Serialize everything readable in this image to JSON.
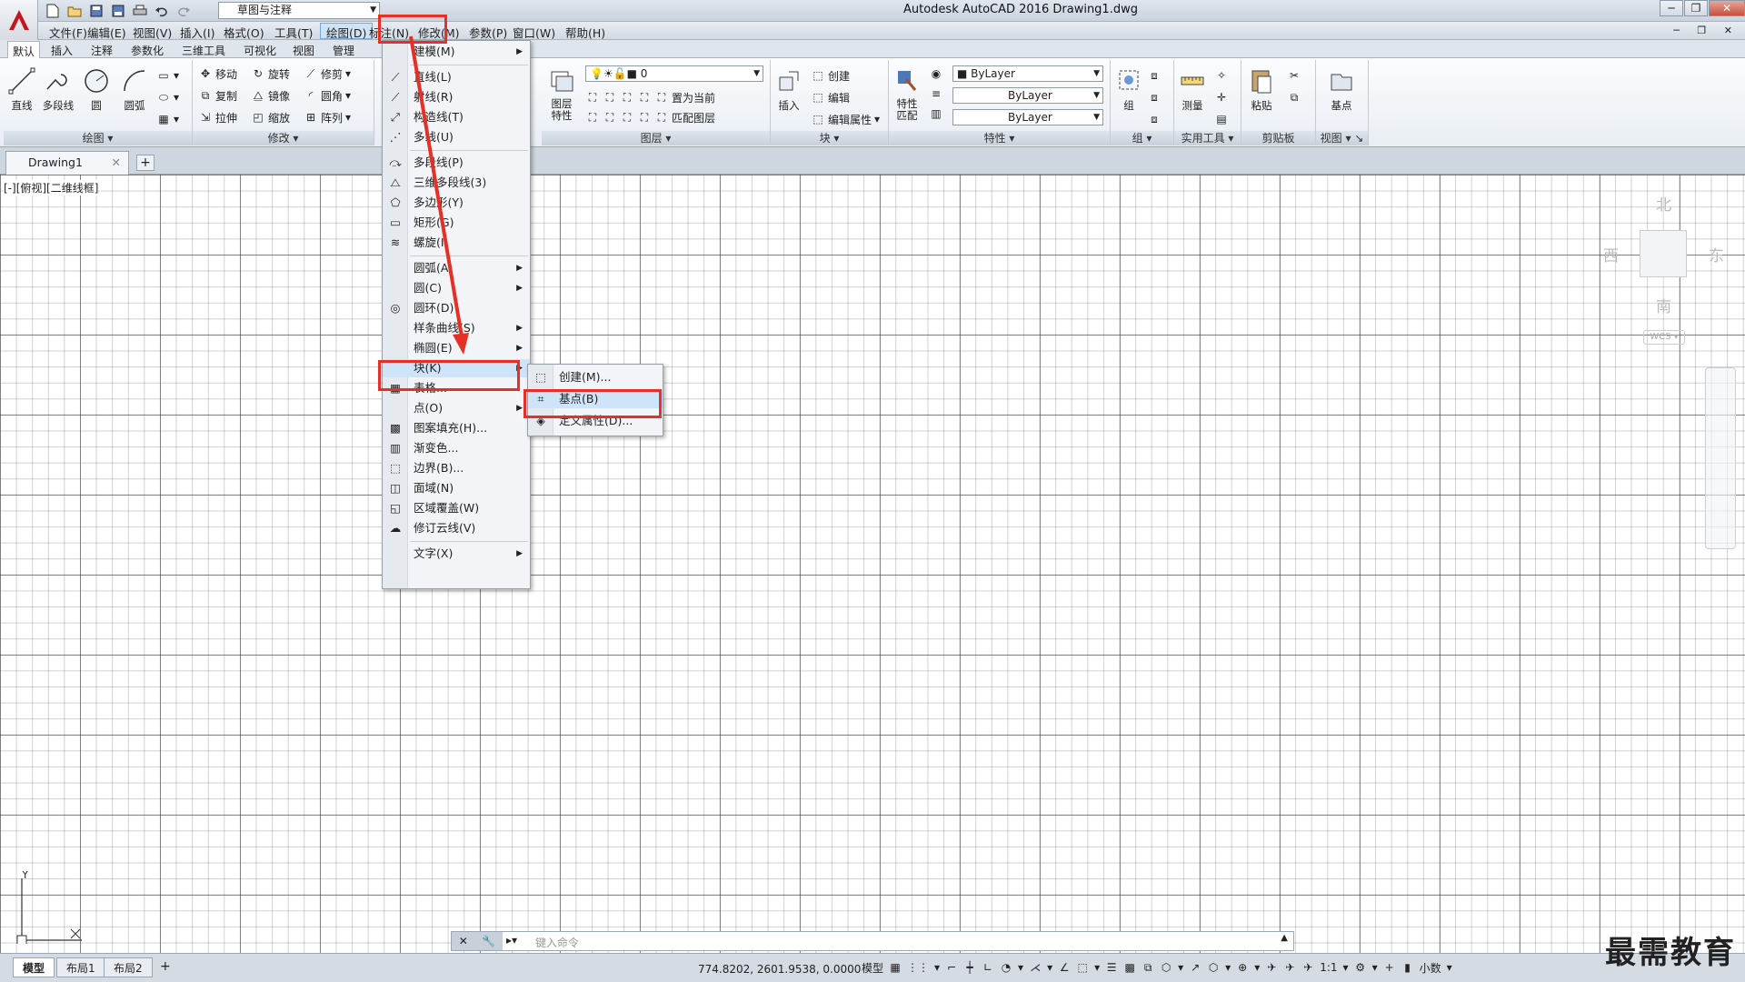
{
  "app": {
    "title": "Autodesk AutoCAD 2016    Drawing1.dwg",
    "workspace": "草图与注释"
  },
  "menubar": [
    "文件(F)",
    "编辑(E)",
    "视图(V)",
    "插入(I)",
    "格式(O)",
    "工具(T)",
    "绘图(D)",
    "标注(N)",
    "修改(M)",
    "参数(P)",
    "窗口(W)",
    "帮助(H)"
  ],
  "ribbon_tabs": [
    "默认",
    "插入",
    "注释",
    "参数化",
    "三维工具",
    "可视化",
    "视图",
    "管理"
  ],
  "panels": {
    "draw": {
      "title": "绘图",
      "line": "直线",
      "polyline": "多段线",
      "circle": "圆",
      "arc": "圆弧"
    },
    "modify": {
      "title": "修改",
      "move": "移动",
      "rotate": "旋转",
      "trim": "修剪",
      "copy": "复制",
      "mirror": "镜像",
      "fillet": "圆角",
      "stretch": "拉伸",
      "scale": "缩放",
      "array": "阵列"
    },
    "layer": {
      "title": "图层",
      "props": "图层\n特性",
      "layer0": "0",
      "setcurrent": "置为当前",
      "match": "匹配图层"
    },
    "block": {
      "title": "块",
      "insert": "插入",
      "create": "创建",
      "edit": "编辑",
      "editattr": "编辑属性"
    },
    "properties": {
      "title": "特性",
      "match": "特性\n匹配",
      "color": "ByLayer",
      "linetype": "ByLayer",
      "lineweight": "ByLayer"
    },
    "group": {
      "title": "组",
      "group": "组"
    },
    "utilities": {
      "title": "实用工具",
      "measure": "测量"
    },
    "clipboard": {
      "title": "剪贴板",
      "paste": "粘贴"
    },
    "view": {
      "title": "视图",
      "base": "基点"
    }
  },
  "doc_tab": "Drawing1",
  "viewport_label": "[-][俯视][二维线框]",
  "viewcube": {
    "n": "北",
    "s": "南",
    "e": "东",
    "w": "西",
    "ucs": "WCS"
  },
  "draw_menu": [
    {
      "label": "建模(M)",
      "sub": true
    },
    {
      "sep": true
    },
    {
      "label": "直线(L)",
      "icon": "line"
    },
    {
      "label": "射线(R)",
      "icon": "ray"
    },
    {
      "label": "构造线(T)",
      "icon": "xline"
    },
    {
      "label": "多线(U)",
      "icon": "mline"
    },
    {
      "sep": true
    },
    {
      "label": "多段线(P)",
      "icon": "pline"
    },
    {
      "label": "三维多段线(3)",
      "icon": "3dpoly"
    },
    {
      "label": "多边形(Y)",
      "icon": "polygon"
    },
    {
      "label": "矩形(G)",
      "icon": "rect"
    },
    {
      "label": "螺旋(I)",
      "icon": "helix"
    },
    {
      "sep": true
    },
    {
      "label": "圆弧(A)",
      "sub": true
    },
    {
      "label": "圆(C)",
      "sub": true
    },
    {
      "label": "圆环(D)",
      "icon": "donut"
    },
    {
      "label": "样条曲线(S)",
      "sub": true
    },
    {
      "label": "椭圆(E)",
      "sub": true
    },
    {
      "label": "块(K)",
      "sub": true,
      "hl": true
    },
    {
      "label": "表格...",
      "icon": "table"
    },
    {
      "label": "点(O)",
      "sub": true
    },
    {
      "label": "图案填充(H)...",
      "icon": "hatch"
    },
    {
      "label": "渐变色...",
      "icon": "gradient"
    },
    {
      "label": "边界(B)...",
      "icon": "boundary"
    },
    {
      "label": "面域(N)",
      "icon": "region"
    },
    {
      "label": "区域覆盖(W)",
      "icon": "wipeout"
    },
    {
      "label": "修订云线(V)",
      "icon": "cloud"
    },
    {
      "sep": true
    },
    {
      "label": "文字(X)",
      "sub": true
    }
  ],
  "block_submenu": [
    "创建(M)...",
    "基点(B)",
    "定义属性(D)..."
  ],
  "command_placeholder": "键入命令",
  "layout_tabs": [
    "模型",
    "布局1",
    "布局2"
  ],
  "coords": "774.8202, 2601.9538, 0.0000",
  "status_model": "模型",
  "status_scale": "1:1",
  "status_units": "小数",
  "watermark": "最需教育"
}
